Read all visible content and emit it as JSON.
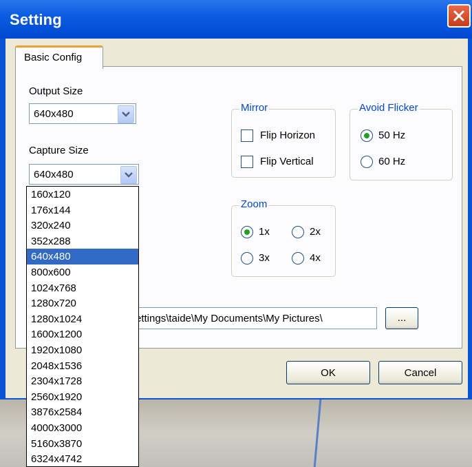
{
  "window": {
    "title": "Setting",
    "close_icon": "close-icon",
    "colors": {
      "titlebar": "#0c5ce2",
      "face": "#ece9d8",
      "selection": "#316ac5",
      "legend": "#0046d5"
    }
  },
  "tabs": [
    {
      "label": "Basic Config",
      "active": true
    }
  ],
  "output_size": {
    "label": "Output Size",
    "value": "640x480"
  },
  "capture_size": {
    "label": "Capture Size",
    "value": "640x480",
    "options": [
      "160x120",
      "176x144",
      "320x240",
      "352x288",
      "640x480",
      "800x600",
      "1024x768",
      "1280x720",
      "1280x1024",
      "1600x1200",
      "1920x1080",
      "2048x1536",
      "2304x1728",
      "2560x1920",
      "3876x2584",
      "4000x3000",
      "5160x3870",
      "6324x4742"
    ],
    "selected": "640x480"
  },
  "mirror": {
    "legend": "Mirror",
    "flip_horizon": {
      "label": "Flip Horizon",
      "checked": false
    },
    "flip_vertical": {
      "label": "Flip Vertical",
      "checked": false
    }
  },
  "avoid_flicker": {
    "legend": "Avoid Flicker",
    "options": [
      {
        "label": "50 Hz",
        "selected": true
      },
      {
        "label": "60 Hz",
        "selected": false
      }
    ]
  },
  "zoom": {
    "legend": "Zoom",
    "options": [
      {
        "label": "1x",
        "selected": true
      },
      {
        "label": "2x",
        "selected": false
      },
      {
        "label": "3x",
        "selected": false
      },
      {
        "label": "4x",
        "selected": false
      }
    ]
  },
  "save_path": {
    "value": "ettings\\taide\\My Documents\\My Pictures\\",
    "browse_label": "..."
  },
  "buttons": {
    "ok": "OK",
    "cancel": "Cancel"
  }
}
